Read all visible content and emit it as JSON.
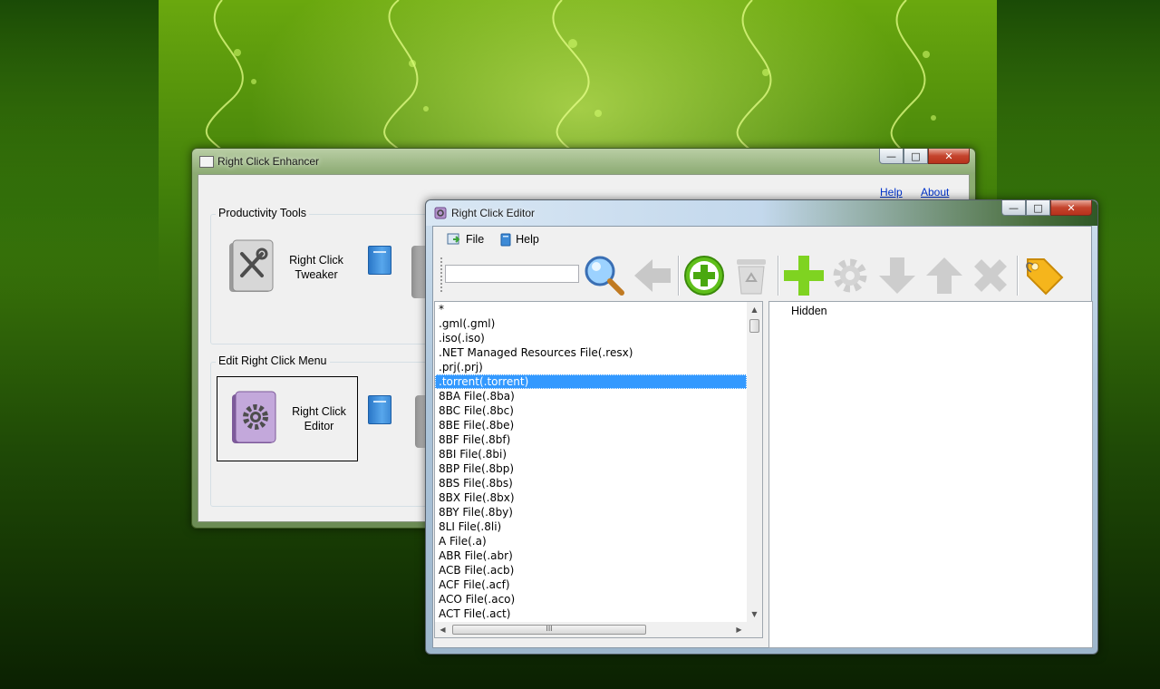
{
  "colors": {
    "selection": "#3399ff",
    "link": "#0033cc",
    "desktop": "#3f7d0a"
  },
  "enhancer": {
    "title": "Right Click Enhancer",
    "links": {
      "help": "Help",
      "about": "About"
    },
    "groups": {
      "productivity": {
        "label": "Productivity Tools",
        "tool_label": "Right Click Tweaker"
      },
      "edit": {
        "label": "Edit Right Click Menu",
        "tool_label": "Right Click Editor"
      }
    }
  },
  "editor": {
    "title": "Right Click Editor",
    "menu": {
      "file": "File",
      "help": "Help"
    },
    "toolbar": {
      "search": {
        "value": "",
        "placeholder": ""
      },
      "icons": [
        "search-icon",
        "back-arrow-icon",
        "add-circle-icon",
        "recycle-bin-icon",
        "add-plus-icon",
        "gear-icon",
        "move-down-icon",
        "move-up-icon",
        "delete-x-icon",
        "tag-icon"
      ]
    },
    "list": {
      "items": [
        "*",
        ".gml(.gml)",
        ".iso(.iso)",
        ".NET Managed Resources File(.resx)",
        ".prj(.prj)",
        ".torrent(.torrent)",
        "8BA File(.8ba)",
        "8BC File(.8bc)",
        "8BE File(.8be)",
        "8BF File(.8bf)",
        "8BI File(.8bi)",
        "8BP File(.8bp)",
        "8BS File(.8bs)",
        "8BX File(.8bx)",
        "8BY File(.8by)",
        "8LI File(.8li)",
        "A File(.a)",
        "ABR File(.abr)",
        "ACB File(.acb)",
        "ACF File(.acf)",
        "ACO File(.aco)",
        "ACT File(.act)"
      ],
      "selected_index": 5,
      "hscroll_grip": "III"
    },
    "properties": {
      "items": [
        "Hidden"
      ]
    }
  }
}
